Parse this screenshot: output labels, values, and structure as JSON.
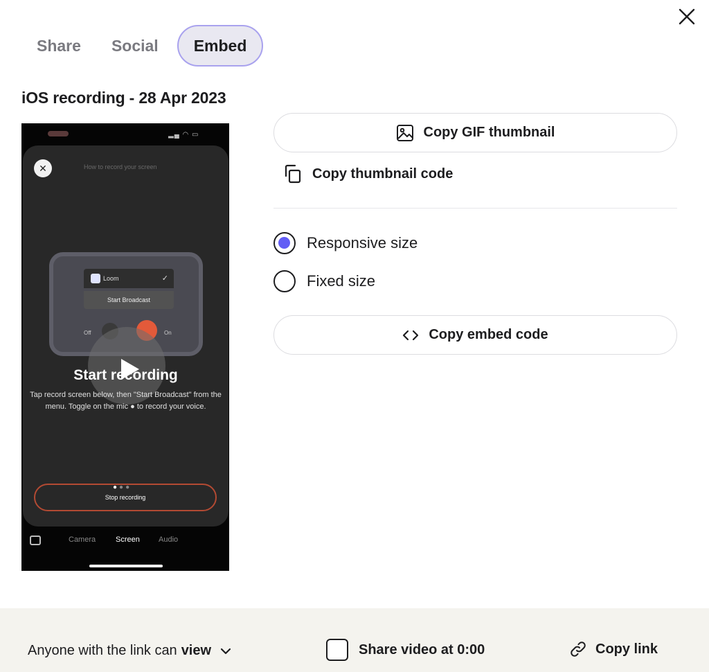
{
  "tabs": [
    {
      "label": "Share",
      "active": false
    },
    {
      "label": "Social",
      "active": false
    },
    {
      "label": "Embed",
      "active": true
    }
  ],
  "video": {
    "title": "iOS recording - 28 Apr 2023",
    "thumbnail": {
      "sheet_title": "How to record your screen",
      "loom_label": "Loom",
      "broadcast_label": "Start Broadcast",
      "off_label": "Off",
      "on_label": "On",
      "heading": "Start recording",
      "description": "Tap record screen below, then \"Start Broadcast\" from the menu. Toggle on the mic ● to record your voice.",
      "stop_label": "Stop recording",
      "tabbar": {
        "camera": "Camera",
        "screen": "Screen",
        "audio": "Audio"
      }
    }
  },
  "actions": {
    "copy_gif": "Copy GIF thumbnail",
    "copy_thumbnail_code": "Copy thumbnail code",
    "copy_embed": "Copy embed code"
  },
  "size_options": [
    {
      "label": "Responsive size",
      "checked": true
    },
    {
      "label": "Fixed size",
      "checked": false
    }
  ],
  "footer": {
    "permission_prefix": "Anyone with the link can",
    "permission_value": "view",
    "share_at": "Share video at 0:00",
    "share_at_checked": false,
    "copy_link": "Copy link"
  },
  "colors": {
    "accent": "#625df5",
    "active_tab_bg": "#e9e8f1",
    "active_tab_border": "#a9a2ee",
    "footer_bg": "#f4f3ee"
  },
  "icons": {
    "close": "close-icon",
    "gif": "image-icon",
    "copy": "copy-icon",
    "embed": "code-icon",
    "chevron": "chevron-down-icon",
    "link": "link-icon"
  }
}
